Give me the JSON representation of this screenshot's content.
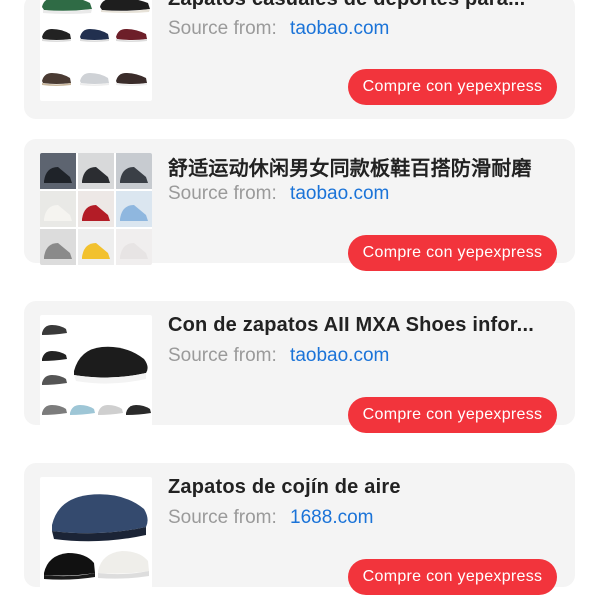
{
  "products": [
    {
      "title": "Zapatos casuales de deportes para...",
      "source_label": "Source from:",
      "source_site": "taobao.com",
      "button_label": "Compre con yepexpress"
    },
    {
      "title": "舒适运动休闲男女同款板鞋百搭防滑耐磨",
      "source_label": "Source from:",
      "source_site": "taobao.com",
      "button_label": "Compre con yepexpress"
    },
    {
      "title": "Con de zapatos AII MXA Shoes infor...",
      "source_label": "Source from:",
      "source_site": "taobao.com",
      "button_label": "Compre con yepexpress"
    },
    {
      "title": "Zapatos de cojín de aire",
      "source_label": "Source from:",
      "source_site": "1688.com",
      "button_label": "Compre con yepexpress"
    }
  ]
}
